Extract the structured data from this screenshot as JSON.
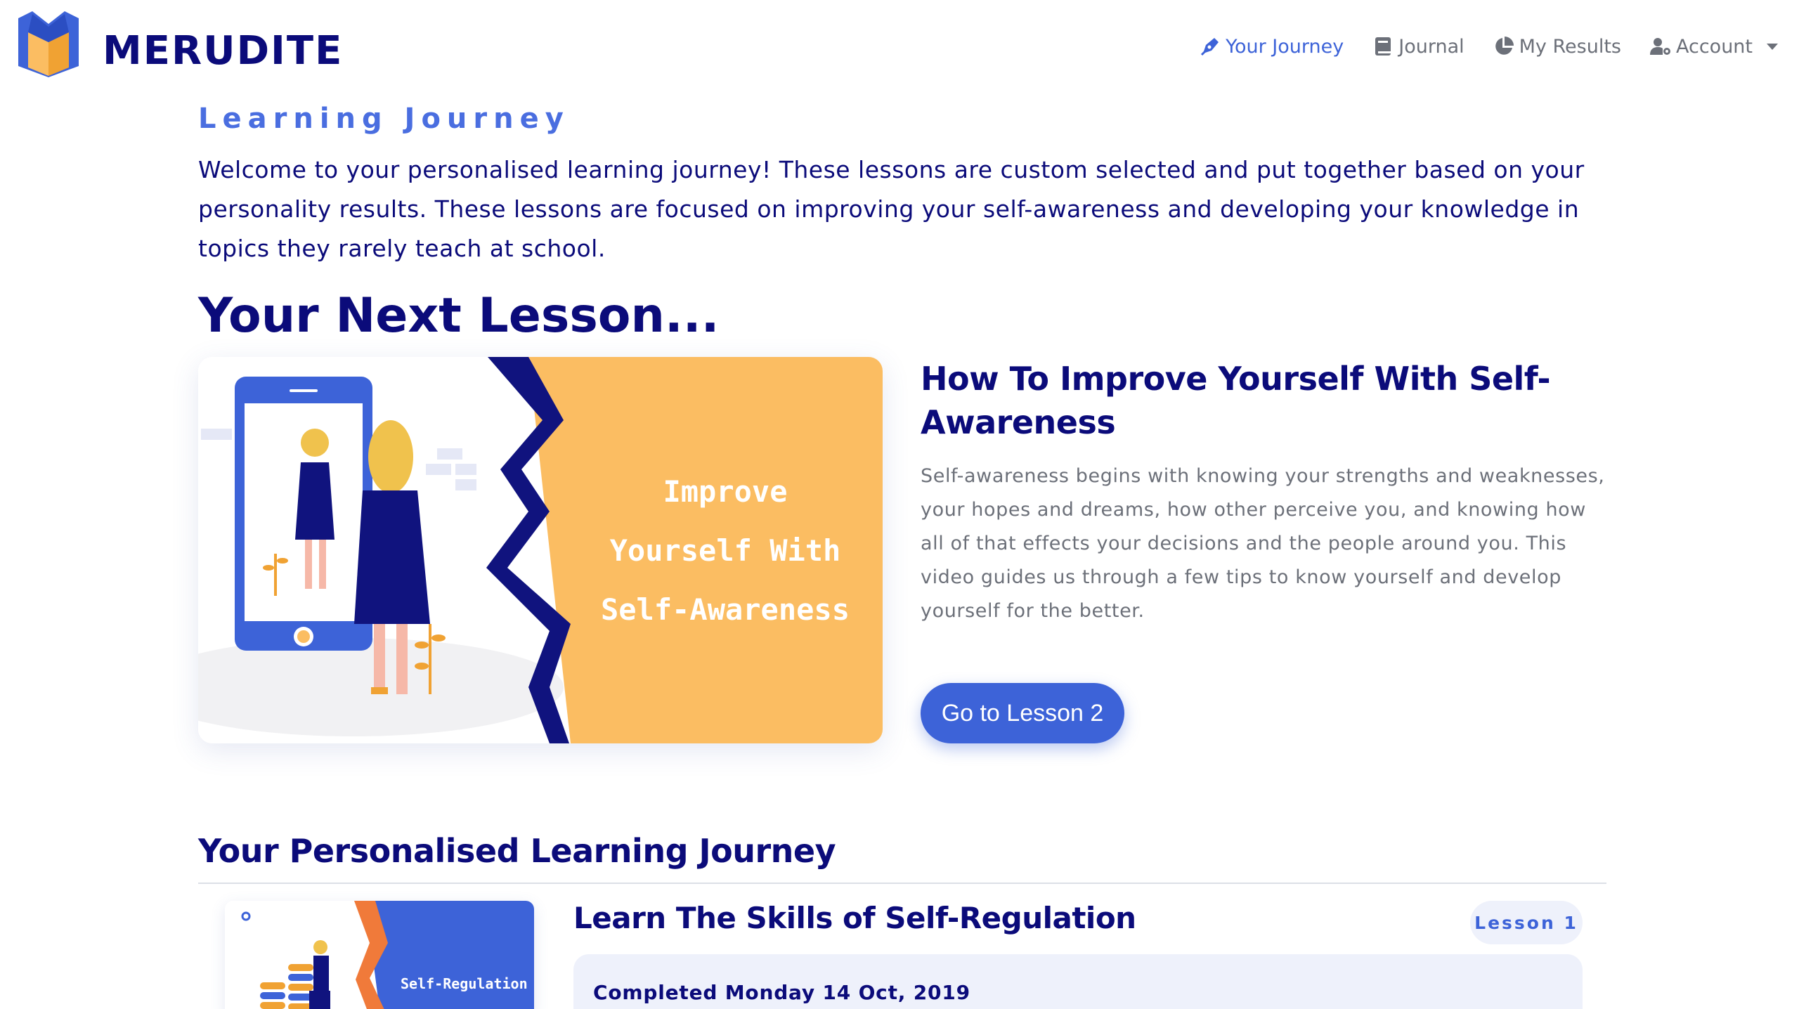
{
  "brand": {
    "name": "MERUDITE",
    "logo_icon": "book-logo-icon"
  },
  "nav": {
    "items": [
      {
        "label": "Your Journey",
        "icon": "pen-nib-icon",
        "active": true
      },
      {
        "label": "Journal",
        "icon": "notebook-icon",
        "active": false
      },
      {
        "label": "My Results",
        "icon": "pie-chart-icon",
        "active": false
      },
      {
        "label": "Account",
        "icon": "user-gear-icon",
        "active": false
      }
    ]
  },
  "page": {
    "section_title": "Learning Journey",
    "intro": "Welcome to your personalised learning journey! These lessons are custom selected and put together based on your personality results. These lessons are focused on improving your self-awareness and developing your knowledge in topics they rarely teach at school.",
    "next_lesson_heading": "Your Next Lesson..."
  },
  "next_lesson": {
    "thumbnail_text_line1": "Improve",
    "thumbnail_text_line2": "Yourself With",
    "thumbnail_text_line3": "Self-Awareness",
    "title": "How To Improve Yourself With Self-Awareness",
    "description": "Self-awareness begins with knowing your strengths and weaknesses, your hopes and dreams, how other perceive you, and knowing how all of that effects your decisions and the people around you. This video guides us through a few tips to know yourself and develop yourself for the better.",
    "button_label": "Go to Lesson 2"
  },
  "journey": {
    "heading": "Your Personalised Learning Journey",
    "items": [
      {
        "thumbnail_text": "Self-Regulation",
        "title": "Learn The Skills of Self-Regulation",
        "badge": "Lesson 1",
        "status": "Completed Monday 14 Oct, 2019"
      }
    ]
  },
  "colors": {
    "navy": "#0b0b7a",
    "accent_blue": "#3d63d8",
    "orange": "#fbbd62",
    "muted_text": "#6c7079"
  }
}
